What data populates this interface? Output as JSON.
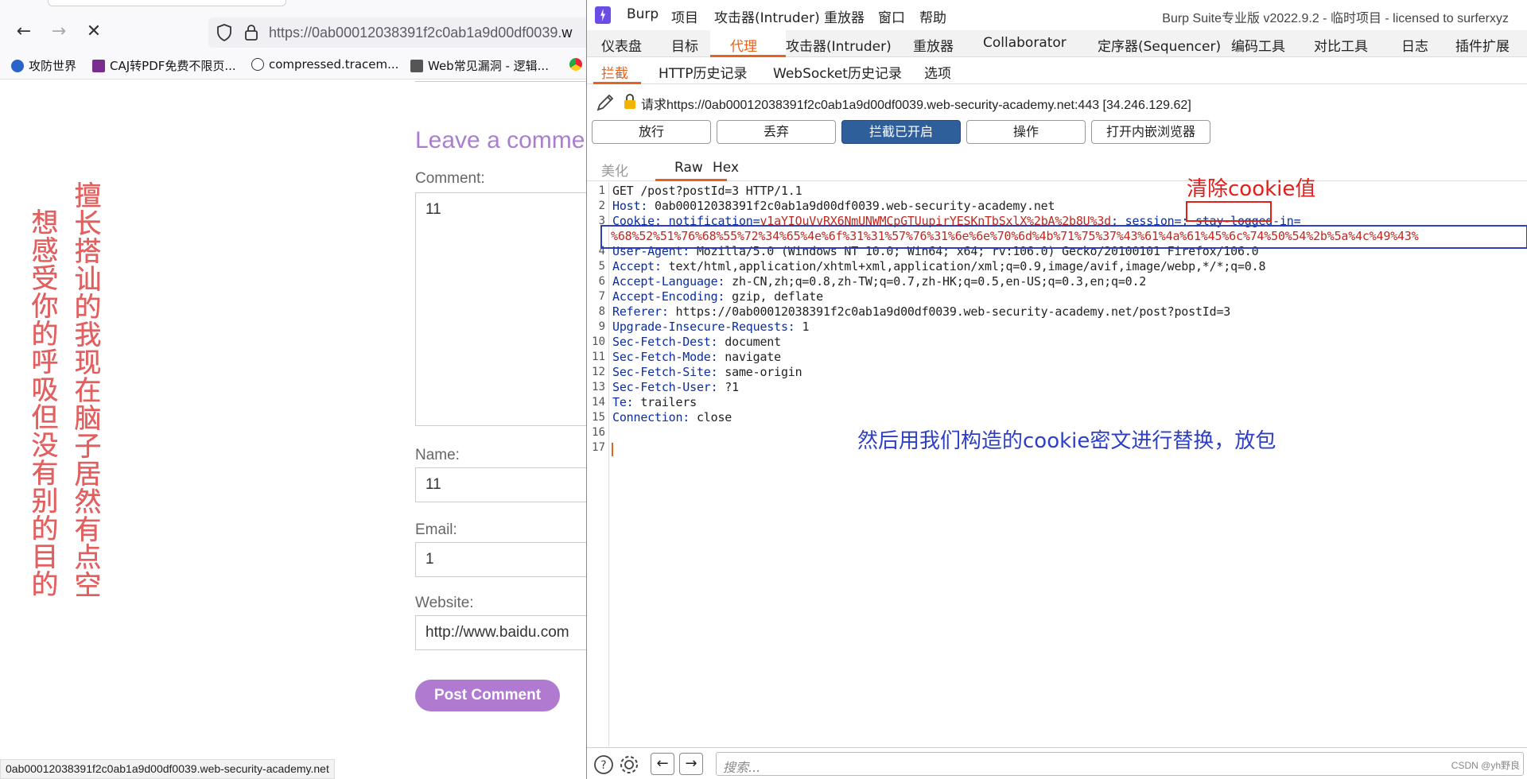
{
  "browser": {
    "url_prefix": "https://0ab00012038391f2c0ab1a9d00df0039.",
    "url_cut": "w",
    "bookmarks": [
      {
        "label": "攻防世界"
      },
      {
        "label": "CAJ转PDF免费不限页..."
      },
      {
        "label": "compressed.tracem..."
      },
      {
        "label": "Web常见漏洞 - 逻辑..."
      }
    ],
    "vertical_text_1": "擅长搭讪的我现在脑子居然有点空",
    "vertical_text_2": "想感受你的呼吸但没有别的目的",
    "heading": "Leave a comme",
    "comment_label": "Comment:",
    "comment_value": "11",
    "name_label": "Name:",
    "name_value": "11",
    "email_label": "Email:",
    "email_value": "1",
    "website_label": "Website:",
    "website_value": "http://www.baidu.com",
    "post_button": "Post Comment",
    "status_url": "0ab00012038391f2c0ab1a9d00df0039.web-security-academy.net"
  },
  "burp": {
    "menu": [
      "Burp",
      "项目",
      "攻击器(Intruder)",
      "重放器",
      "窗口",
      "帮助"
    ],
    "window_title": "Burp Suite专业版  v2022.9.2 - 临时项目 - licensed to surferxyz",
    "main_tabs": [
      "仪表盘",
      "目标",
      "代理",
      "攻击器(Intruder)",
      "重放器",
      "Collaborator",
      "定序器(Sequencer)",
      "编码工具",
      "对比工具",
      "日志",
      "插件扩展"
    ],
    "active_main_tab": "代理",
    "sub_tabs": [
      "拦截",
      "HTTP历史记录",
      "WebSocket历史记录",
      "选项"
    ],
    "request_info": "请求https://0ab00012038391f2c0ab1a9d00df0039.web-security-academy.net:443  [34.246.129.62]",
    "buttons": {
      "forward": "放行",
      "drop": "丢弃",
      "intercept": "拦截已开启",
      "action": "操作",
      "browser": "打开内嵌浏览器"
    },
    "view_tabs": [
      "美化",
      "Raw",
      "Hex"
    ],
    "line_numbers": [
      "1",
      "2",
      "3",
      "4",
      "5",
      "6",
      "7",
      "8",
      "9",
      "10",
      "11",
      "12",
      "13",
      "14",
      "15",
      "16",
      "17"
    ],
    "request": {
      "l1": "GET /post?postId=3 HTTP/1.1",
      "host_k": "Host:",
      "host_v": " 0ab00012038391f2c0ab1a9d00df0039.web-security-academy.net",
      "cookie_k": "Cookie:",
      "cookie_n1": " notification=",
      "cookie_v1": "v1aYIOuVvRX6NmUNWMCpGTUupirYESKnTbSxlX%2bA%2b8U%3d",
      "cookie_s": "; session=; stay-logged-in=",
      "cookie_v2": "%68%52%51%76%68%55%72%34%65%4e%6f%31%31%57%76%31%6e%6e%70%6d%4b%71%75%37%43%61%4a%61%45%6c%74%50%54%2b%5a%4c%49%43%",
      "ua_k": "User-Agent:",
      "ua_v": " Mozilla/5.0 (Windows NT 10.0; Win64; x64; rv:106.0) Gecko/20100101 Firefox/106.0",
      "accept_k": "Accept:",
      "accept_v": " text/html,application/xhtml+xml,application/xml;q=0.9,image/avif,image/webp,*/*;q=0.8",
      "al_k": "Accept-Language:",
      "al_v": " zh-CN,zh;q=0.8,zh-TW;q=0.7,zh-HK;q=0.5,en-US;q=0.3,en;q=0.2",
      "ae_k": "Accept-Encoding:",
      "ae_v": " gzip, deflate",
      "ref_k": "Referer:",
      "ref_v": " https://0ab00012038391f2c0ab1a9d00df0039.web-security-academy.net/post?postId=3",
      "uir_k": "Upgrade-Insecure-Requests:",
      "uir_v": " 1",
      "sfd_k": "Sec-Fetch-Dest:",
      "sfd_v": " document",
      "sfm_k": "Sec-Fetch-Mode:",
      "sfm_v": " navigate",
      "sfs_k": "Sec-Fetch-Site:",
      "sfs_v": " same-origin",
      "sfu_k": "Sec-Fetch-User:",
      "sfu_v": " ?1",
      "te_k": "Te:",
      "te_v": " trailers",
      "conn_k": "Connection:",
      "conn_v": " close"
    },
    "annotation_red": "清除cookie值",
    "annotation_blue": "然后用我们构造的cookie密文进行替换，放包",
    "search_placeholder": "搜索...",
    "watermark": "CSDN @yh野良"
  }
}
